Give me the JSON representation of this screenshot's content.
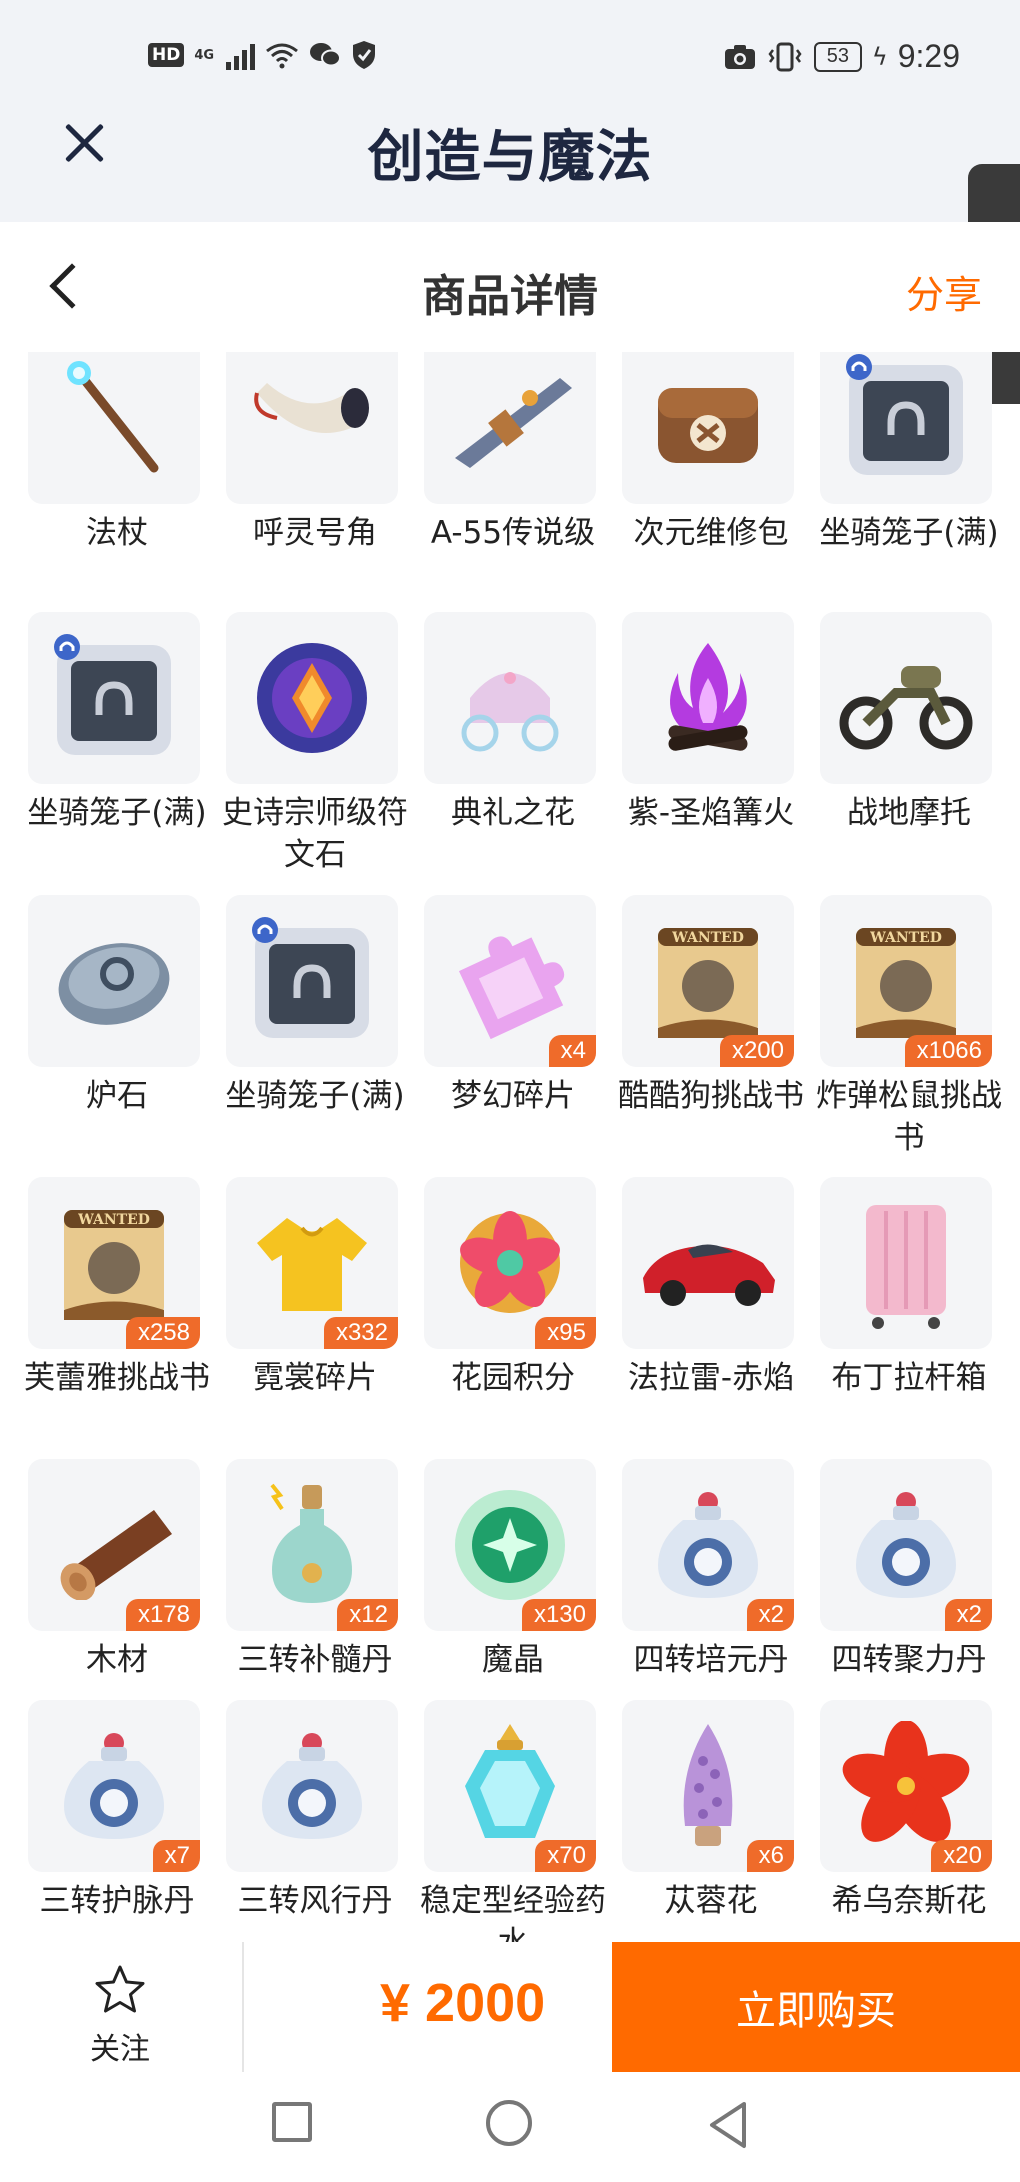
{
  "status_bar": {
    "hd": "HD",
    "network": "4G",
    "battery": "53",
    "time": "9:29"
  },
  "app": {
    "title": "创造与魔法"
  },
  "page_header": {
    "title": "商品详情",
    "share": "分享"
  },
  "items": [
    {
      "name": "法杖",
      "qty": "",
      "icon": "staff-icon"
    },
    {
      "name": "呼灵号角",
      "qty": "",
      "icon": "horn-icon"
    },
    {
      "name": "A-55传说级",
      "qty": "",
      "icon": "gun-icon"
    },
    {
      "name": "次元维修包",
      "qty": "",
      "icon": "repair-bag-icon"
    },
    {
      "name": "坐骑笼子(满)",
      "qty": "",
      "icon": "mount-cage-icon"
    },
    {
      "name": "坐骑笼子(满)",
      "qty": "",
      "icon": "mount-cage-icon"
    },
    {
      "name": "史诗宗师级符文石",
      "qty": "",
      "icon": "rune-stone-icon"
    },
    {
      "name": "典礼之花",
      "qty": "",
      "icon": "carriage-icon"
    },
    {
      "name": "紫-圣焰篝火",
      "qty": "",
      "icon": "bonfire-icon"
    },
    {
      "name": "战地摩托",
      "qty": "",
      "icon": "motorbike-icon"
    },
    {
      "name": "炉石",
      "qty": "",
      "icon": "hearthstone-icon"
    },
    {
      "name": "坐骑笼子(满)",
      "qty": "",
      "icon": "mount-cage-icon"
    },
    {
      "name": "梦幻碎片",
      "qty": "x4",
      "icon": "puzzle-icon"
    },
    {
      "name": "酷酷狗挑战书",
      "qty": "x200",
      "icon": "wanted-scroll-icon"
    },
    {
      "name": "炸弹松鼠挑战书",
      "qty": "x1066",
      "icon": "wanted-scroll-icon"
    },
    {
      "name": "芙蕾雅挑战书",
      "qty": "x258",
      "icon": "wanted-scroll-icon"
    },
    {
      "name": "霓裳碎片",
      "qty": "x332",
      "icon": "shirt-icon"
    },
    {
      "name": "花园积分",
      "qty": "x95",
      "icon": "flower-badge-icon"
    },
    {
      "name": "法拉雷-赤焰",
      "qty": "",
      "icon": "sports-car-icon"
    },
    {
      "name": "布丁拉杆箱",
      "qty": "",
      "icon": "suitcase-icon"
    },
    {
      "name": "木材",
      "qty": "x178",
      "icon": "wood-log-icon"
    },
    {
      "name": "三转补髓丹",
      "qty": "x12",
      "icon": "potion-bottle-icon"
    },
    {
      "name": "魔晶",
      "qty": "x130",
      "icon": "magic-crystal-icon"
    },
    {
      "name": "四转培元丹",
      "qty": "x2",
      "icon": "elixir-flask-icon"
    },
    {
      "name": "四转聚力丹",
      "qty": "x2",
      "icon": "elixir-flask-icon"
    },
    {
      "name": "三转护脉丹",
      "qty": "x7",
      "icon": "elixir-flask-icon"
    },
    {
      "name": "三转风行丹",
      "qty": "",
      "icon": "elixir-flask-icon"
    },
    {
      "name": "稳定型经验药水",
      "qty": "x70",
      "icon": "exp-potion-icon"
    },
    {
      "name": "苁蓉花",
      "qty": "x6",
      "icon": "cistanche-flower-icon"
    },
    {
      "name": "希乌奈斯花",
      "qty": "x20",
      "icon": "red-flower-icon"
    }
  ],
  "bottom_bar": {
    "follow_label": "关注",
    "price": "¥ 2000",
    "buy_label": "立即购买"
  },
  "colors": {
    "accent": "#ff6a00",
    "qty_badge": "#ef6b2a",
    "title": "#1e2740"
  }
}
